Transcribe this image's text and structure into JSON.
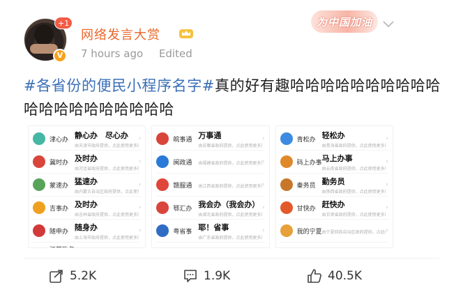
{
  "user": {
    "name": "网络发言大赏",
    "follow_badge": "+1",
    "time": "7 hours ago",
    "edited": "Edited"
  },
  "promo": {
    "text": "为中国加油"
  },
  "post": {
    "hashtag": "#各省份的便民小程序名字#",
    "text": "真的好有趣哈哈哈哈哈哈哈哈哈哈哈哈哈哈哈哈哈哈哈哈"
  },
  "image_panels": [
    {
      "items": [
        {
          "app": "津心办",
          "label": "静心办　尽心办",
          "sub": "由天津市政府提供，点此使用更多服务",
          "color": "#45b7a4",
          "icon": "leaf-icon"
        },
        {
          "app": "冀时办",
          "label": "及时办",
          "sub": "由河北省政府提供，点此使用更多服务",
          "color": "#d9453b",
          "icon": "seal-icon"
        },
        {
          "app": "蒙速办",
          "label": "猛速办",
          "sub": "由内蒙古自治区政府提供，点此使用更多服务",
          "color": "#58a35a",
          "icon": "grass-icon"
        },
        {
          "app": "吉事办",
          "label": "及时办",
          "sub": "由吉林省政府提供，点此使用更多服务",
          "color": "#f0a020",
          "icon": "bird-icon"
        },
        {
          "app": "随申办",
          "label": "随身办",
          "sub": "由上海市政府提供，点此使用更多服务",
          "color": "#d23a3a",
          "icon": "flower-icon"
        },
        {
          "app": "江苏政务服务",
          "label": "",
          "sub": "",
          "color": "#3a86c8",
          "icon": "circle-icon"
        }
      ]
    },
    {
      "items": [
        {
          "app": "皖事通",
          "label": "万事通",
          "sub": "由安徽省政府提供，点此使用更多服务",
          "color": "#d9453b",
          "icon": "badge-icon"
        },
        {
          "app": "闽政通",
          "label": "",
          "sub": "由福建省政府提供，点此使用更多服务",
          "color": "#2a7ad8",
          "icon": "swirl-icon"
        },
        {
          "app": "赣服通",
          "label": "",
          "sub": "由江西省政府提供，点此使用更多服务",
          "color": "#e0453a",
          "icon": "square-icon"
        },
        {
          "app": "鄂汇办",
          "label": "我会办（我会办）",
          "sub": "由湖北省政府提供，点此使用更多服务",
          "color": "#d9453b",
          "icon": "ring-icon"
        },
        {
          "app": "粤省事",
          "label": "耶！省事",
          "sub": "由广东省政府提供，点此使用更多服务",
          "color": "#2f6cc4",
          "icon": "star-icon"
        },
        {
          "app": "爱山东",
          "label": "",
          "sub": "",
          "color": "#d9453b",
          "icon": "heart-icon"
        }
      ]
    },
    {
      "items": [
        {
          "app": "青松办",
          "label": "轻松办",
          "sub": "由青海省政府提供，点此使用更多服务",
          "color": "#3c8be0",
          "icon": "pine-icon"
        },
        {
          "app": "码上办事",
          "label": "马上办事",
          "sub": "由云南省政府提供，点此使用更多服务",
          "color": "#e0892a",
          "icon": "qr-icon"
        },
        {
          "app": "秦务员",
          "label": "勤务员",
          "sub": "由陕西省政府提供，点此使用更多服务",
          "color": "#c8772a",
          "icon": "dome-icon"
        },
        {
          "app": "甘快办",
          "label": "赶快办",
          "sub": "由甘肃省政府提供，点此使用更多服务",
          "color": "#e35a2a",
          "icon": "sun-icon"
        },
        {
          "app": "我的宁夏",
          "label": "",
          "sub": "由宁夏回族自治区政府提供，点此使用更多服务",
          "color": "#e6a13a",
          "icon": "face-icon"
        }
      ]
    }
  ],
  "actions": {
    "share": "5.2K",
    "comment": "1.9K",
    "like": "40.5K"
  },
  "colors": {
    "username": "#e8672a",
    "hashtag": "#3a6fb6",
    "meta": "#9a9a9a"
  }
}
